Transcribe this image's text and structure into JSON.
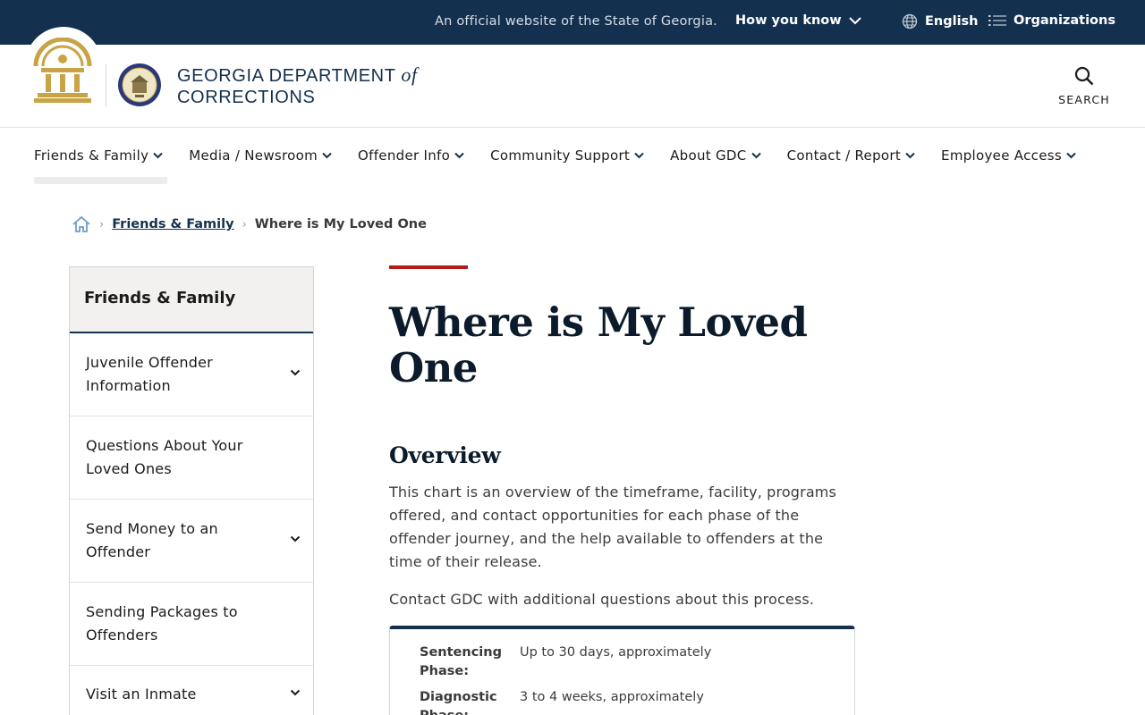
{
  "topbar": {
    "official_text": "An official website of the State of Georgia.",
    "how_you_know": "How you know",
    "language": "English",
    "organizations": "Organizations"
  },
  "header": {
    "title_line1": "GEORGIA DEPARTMENT",
    "title_of": "of",
    "title_line2": "CORRECTIONS",
    "search_label": "SEARCH"
  },
  "nav": {
    "items": [
      {
        "label": "Friends & Family"
      },
      {
        "label": "Media / Newsroom"
      },
      {
        "label": "Offender Info"
      },
      {
        "label": "Community Support"
      },
      {
        "label": "About GDC"
      },
      {
        "label": "Contact / Report"
      },
      {
        "label": "Employee Access"
      }
    ]
  },
  "breadcrumb": {
    "parent": "Friends & Family",
    "current": "Where is My Loved One"
  },
  "sidenav": {
    "heading": "Friends & Family",
    "items": [
      {
        "label": "Juvenile Offender Information",
        "expandable": true
      },
      {
        "label": "Questions About Your Loved Ones",
        "expandable": false
      },
      {
        "label": "Send Money to an Offender",
        "expandable": true
      },
      {
        "label": "Sending Packages to Offenders",
        "expandable": false
      },
      {
        "label": "Visit an Inmate",
        "expandable": true
      }
    ]
  },
  "main": {
    "title": "Where is My Loved One",
    "section_heading": "Overview",
    "paragraph1": "This chart is an overview of the timeframe, facility, programs offered, and contact opportunities for each phase of the offender journey, and the help available to offenders at the time of their release.",
    "paragraph2": "Contact GDC with additional questions about this process.",
    "phases": [
      {
        "phase": "Sentencing Phase:",
        "timeframe": "Up to 30 days, approximately"
      },
      {
        "phase": "Diagnostic Phase:",
        "timeframe": "3 to 4 weeks, approximately"
      }
    ]
  },
  "colors": {
    "navy": "#14304f",
    "red_accent": "#b31b1b",
    "gold": "#c9a446"
  }
}
